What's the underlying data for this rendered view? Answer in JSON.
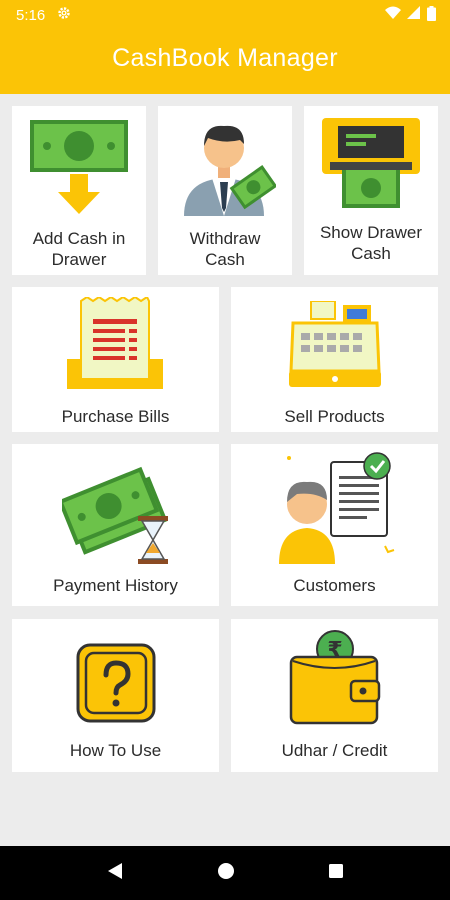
{
  "status_bar": {
    "time": "5:16"
  },
  "app": {
    "title": "CashBook Manager"
  },
  "tiles": {
    "add_cash": {
      "label_line1": "Add Cash in",
      "label_line2": "Drawer"
    },
    "withdraw": {
      "label_line1": "Withdraw",
      "label_line2": "Cash"
    },
    "show_drawer": {
      "label_line1": "Show Drawer",
      "label_line2": "Cash"
    },
    "purchase_bills": {
      "label": "Purchase Bills"
    },
    "sell_products": {
      "label": "Sell Products"
    },
    "payment_history": {
      "label": "Payment History"
    },
    "customers": {
      "label": "Customers"
    },
    "how_to_use": {
      "label": "How To Use"
    },
    "udhar_credit": {
      "label": "Udhar / Credit"
    }
  },
  "colors": {
    "accent": "#fbc406",
    "background": "#ececec",
    "card": "#ffffff",
    "money_green": "#5fb94a"
  },
  "icons": {
    "settings": "gear-icon",
    "wifi": "wifi-icon",
    "signal": "signal-icon",
    "battery": "battery-icon",
    "back": "back-icon",
    "home": "home-icon",
    "recents": "recents-icon"
  }
}
